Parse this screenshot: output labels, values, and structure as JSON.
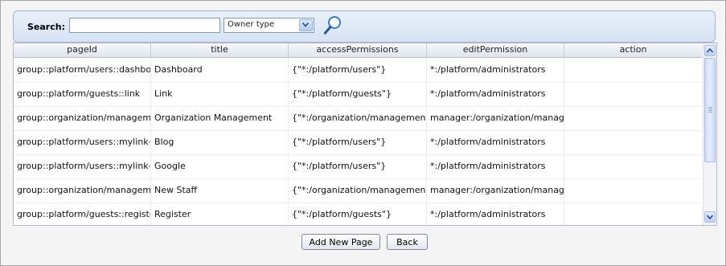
{
  "search": {
    "label": "Search:",
    "value": "",
    "placeholder": "",
    "owner_type": {
      "selected": "Owner type"
    },
    "search_icon": "magnifier-icon"
  },
  "table": {
    "columns": [
      "pageId",
      "title",
      "accessPermissions",
      "editPermission",
      "action"
    ],
    "rows": [
      {
        "pageId": "group::platform/users::dashboard",
        "title": "Dashboard",
        "accessPermissions": "{\"*:/platform/users\"}",
        "editPermission": "*:/platform/administrators"
      },
      {
        "pageId": "group::platform/guests::link",
        "title": "Link",
        "accessPermissions": "{\"*:/platform/guests\"}",
        "editPermission": "*:/platform/administrators"
      },
      {
        "pageId": "group::organization/management/executive-board::",
        "title": "Organization Management",
        "accessPermissions": "{\"*:/organization/management/executive-board\"}",
        "editPermission": "manager:/organization/management/executive-board"
      },
      {
        "pageId": "group::platform/users::mylink-blog",
        "title": "Blog",
        "accessPermissions": "{\"*:/platform/users\"}",
        "editPermission": "*:/platform/administrators"
      },
      {
        "pageId": "group::platform/users::mylink-google",
        "title": "Google",
        "accessPermissions": "{\"*:/platform/users\"}",
        "editPermission": "*:/platform/administrators"
      },
      {
        "pageId": "group::organization/management/executive-board::",
        "title": "New Staff",
        "accessPermissions": "{\"*:/organization/management/executive-board\"}",
        "editPermission": "manager:/organization/management/executive-board"
      },
      {
        "pageId": "group::platform/guests::register",
        "title": "Register",
        "accessPermissions": "{\"*:/platform/guests\"}",
        "editPermission": "*:/platform/administrators"
      }
    ],
    "action_icons": [
      "preview-icon",
      "edit-icon",
      "delete-icon"
    ]
  },
  "buttons": {
    "add_new_page": "Add New Page",
    "back": "Back"
  },
  "colors": {
    "search_bar_border": "#9fb5d6",
    "search_bar_bg": "#dfe8f6",
    "header_bg": "#e8ecf2"
  }
}
